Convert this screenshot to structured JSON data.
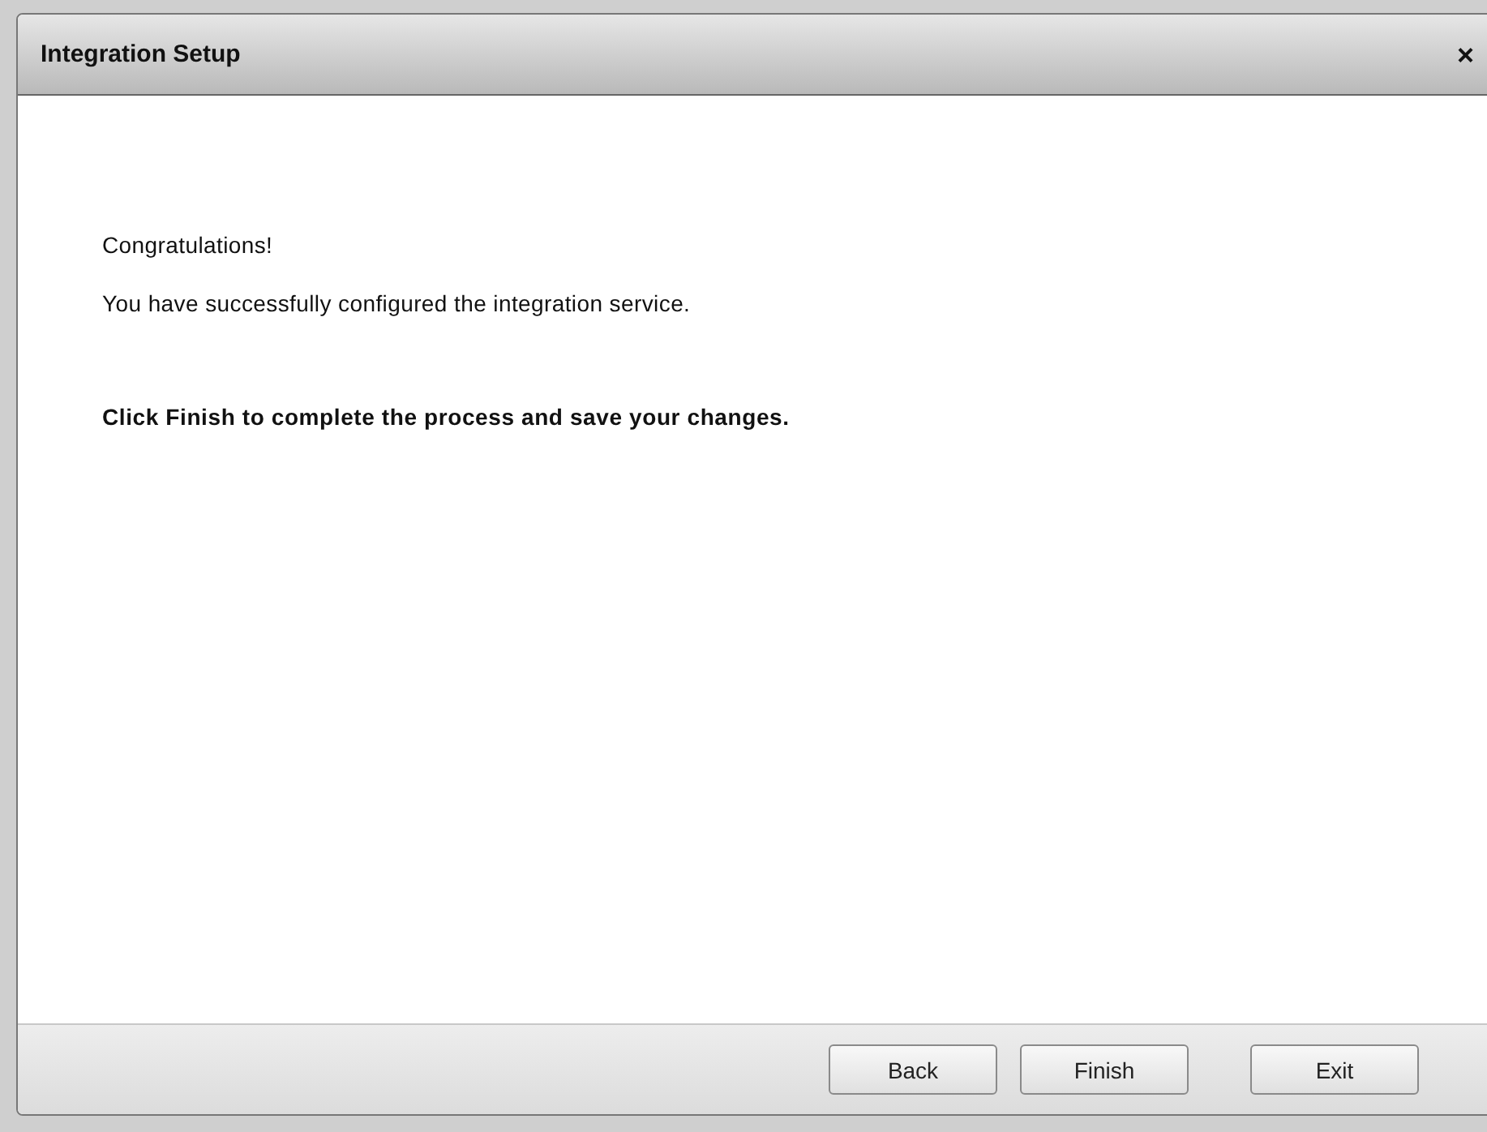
{
  "dialog": {
    "title": "Integration Setup",
    "close_icon": "×",
    "paragraphs": [
      {
        "text": "Congratulations!",
        "kind": "normal"
      },
      {
        "text": "You have successfully configured the integration service.",
        "kind": "normal"
      },
      {
        "text": "Click Finish to complete the process and save your changes.",
        "kind": "bold"
      }
    ],
    "buttons": [
      {
        "label": "Back",
        "kind": "nav"
      },
      {
        "label": "Finish",
        "kind": "nav"
      },
      {
        "label": "Exit",
        "kind": "exit"
      }
    ]
  }
}
